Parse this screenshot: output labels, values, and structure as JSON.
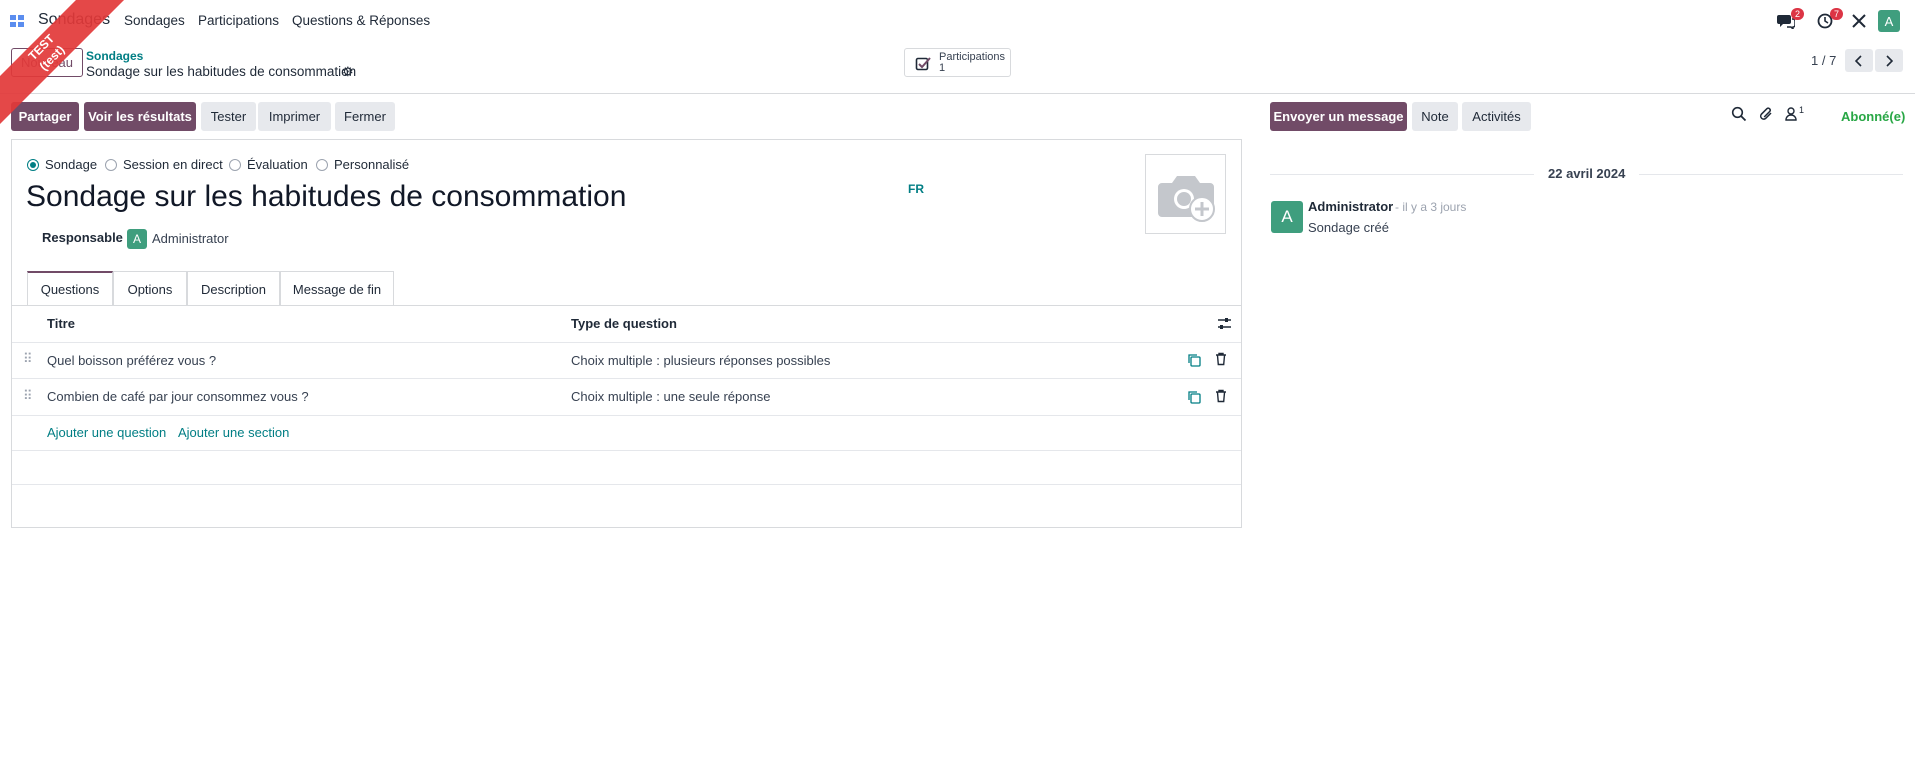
{
  "ribbon": {
    "line1": "TEST",
    "line2": "(test)"
  },
  "nav": {
    "app_name": "Sondages",
    "menu": [
      "Sondages",
      "Participations",
      "Questions & Réponses"
    ],
    "messages_badge": "2",
    "activities_badge": "7",
    "user_initial": "A"
  },
  "control": {
    "new_button": "Nouveau",
    "breadcrumb_parent": "Sondages",
    "record_name": "Sondage sur les habitudes de consommation",
    "smart_button": {
      "label": "Participations",
      "value": "1"
    },
    "pager": "1 / 7"
  },
  "actions": {
    "share": "Partager",
    "results": "Voir les résultats",
    "test": "Tester",
    "print": "Imprimer",
    "close": "Fermer"
  },
  "form": {
    "survey_types": [
      {
        "label": "Sondage",
        "selected": true
      },
      {
        "label": "Session en direct",
        "selected": false
      },
      {
        "label": "Évaluation",
        "selected": false
      },
      {
        "label": "Personnalisé",
        "selected": false
      }
    ],
    "title": "Sondage sur les habitudes de consommation",
    "lang": "FR",
    "responsible_label": "Responsable",
    "responsible_initial": "A",
    "responsible_name": "Administrator"
  },
  "tabs": [
    {
      "label": "Questions",
      "active": true
    },
    {
      "label": "Options",
      "active": false
    },
    {
      "label": "Description",
      "active": false
    },
    {
      "label": "Message de fin",
      "active": false
    }
  ],
  "table": {
    "headers": {
      "title": "Titre",
      "type": "Type de question"
    },
    "rows": [
      {
        "title": "Quel boisson préférez vous ?",
        "type": "Choix multiple : plusieurs réponses possibles"
      },
      {
        "title": "Combien de café par jour consommez vous ?",
        "type": "Choix multiple : une seule réponse"
      }
    ],
    "add_question": "Ajouter une question",
    "add_section": "Ajouter une section"
  },
  "chatter": {
    "send_message": "Envoyer un message",
    "note": "Note",
    "activities": "Activités",
    "followers_count": "1",
    "follow_status": "Abonné(e)",
    "date": "22 avril 2024",
    "message": {
      "initial": "A",
      "author": "Administrator",
      "time": "- il y a 3 jours",
      "body": "Sondage créé"
    }
  },
  "colors": {
    "brand": "#714b67",
    "link": "#017e84",
    "avatar": "#3f9e7e",
    "badge": "#dc3545",
    "follow": "#28a745"
  }
}
